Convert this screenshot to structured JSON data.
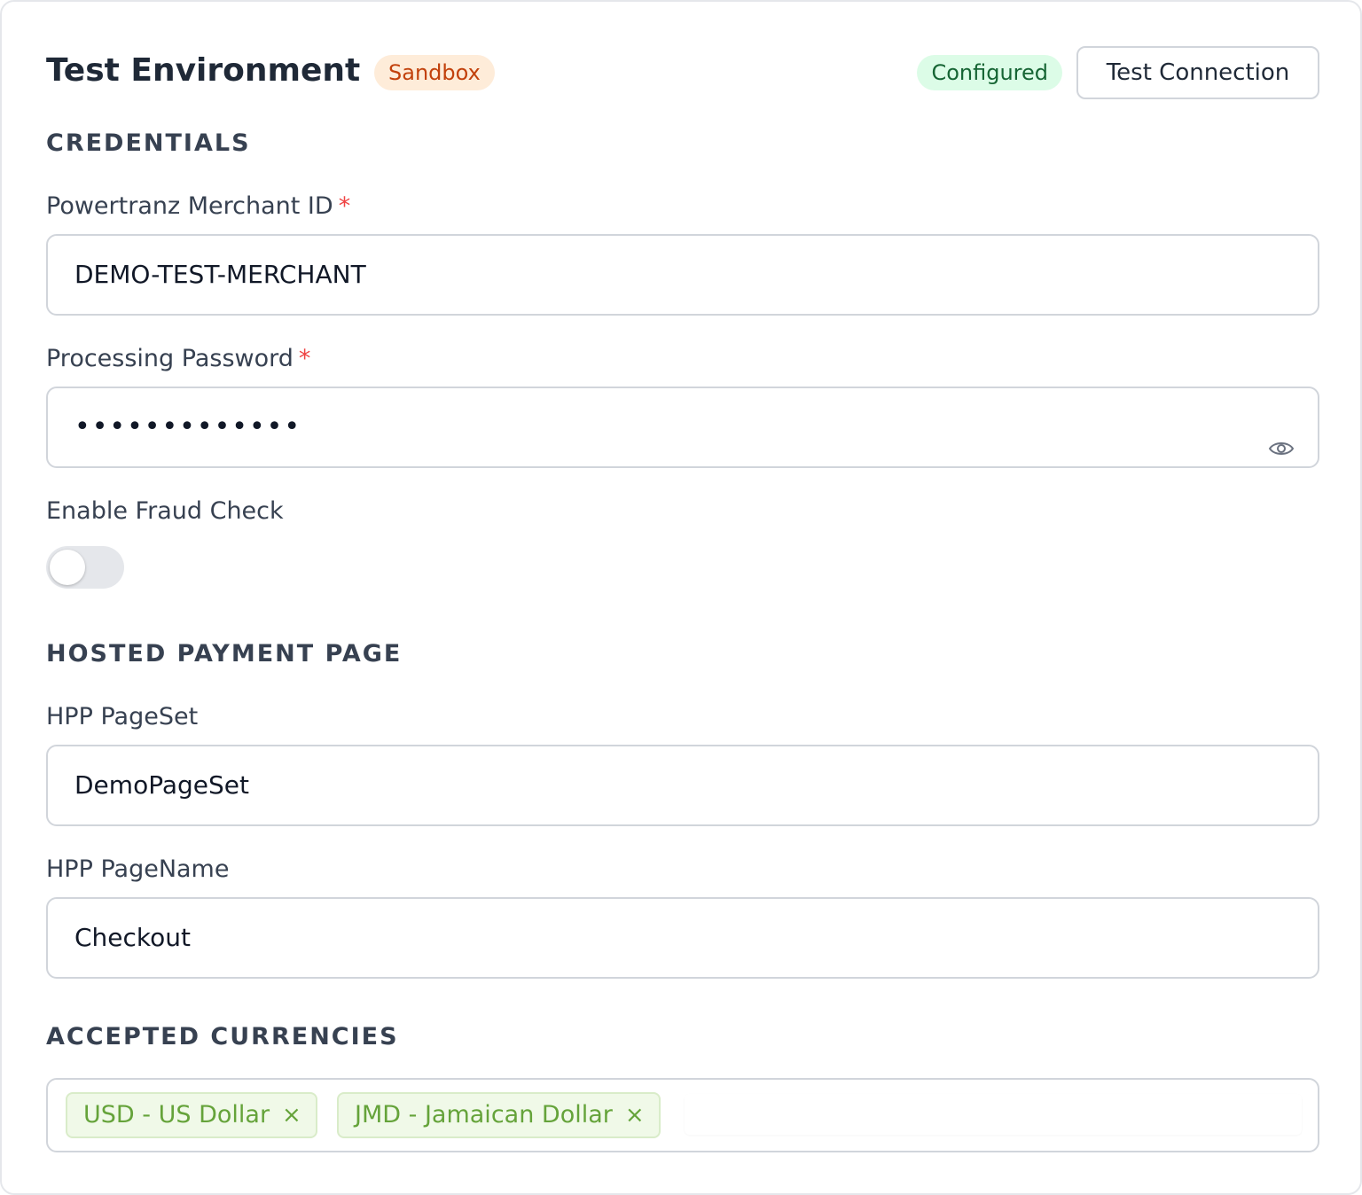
{
  "header": {
    "title": "Test Environment",
    "env_badge": "Sandbox",
    "status_badge": "Configured",
    "test_button_label": "Test Connection"
  },
  "credentials": {
    "heading": "CREDENTIALS",
    "merchant_id": {
      "label": "Powertranz Merchant ID",
      "required_mark": "*",
      "value": "DEMO-TEST-MERCHANT"
    },
    "password": {
      "label": "Processing Password",
      "required_mark": "*",
      "masked_value": "•••••••••••••",
      "toggle_icon": "eye-icon"
    },
    "fraud_check": {
      "label": "Enable Fraud Check",
      "enabled": false
    }
  },
  "hosted_payment_page": {
    "heading": "HOSTED PAYMENT PAGE",
    "pageset": {
      "label": "HPP PageSet",
      "value": "DemoPageSet"
    },
    "pagename": {
      "label": "HPP PageName",
      "value": "Checkout"
    }
  },
  "accepted_currencies": {
    "heading": "ACCEPTED CURRENCIES",
    "tags": [
      {
        "label": "USD - US Dollar",
        "remove": "×"
      },
      {
        "label": "JMD - Jamaican Dollar",
        "remove": "×"
      }
    ]
  },
  "colors": {
    "sandbox_badge_bg": "#feecd9",
    "sandbox_badge_text": "#c2410c",
    "configured_badge_bg": "#dcfce7",
    "configured_badge_text": "#166534",
    "required_mark": "#ef4444",
    "tag_bg": "#f0f9e8",
    "tag_text": "#65a33a"
  }
}
